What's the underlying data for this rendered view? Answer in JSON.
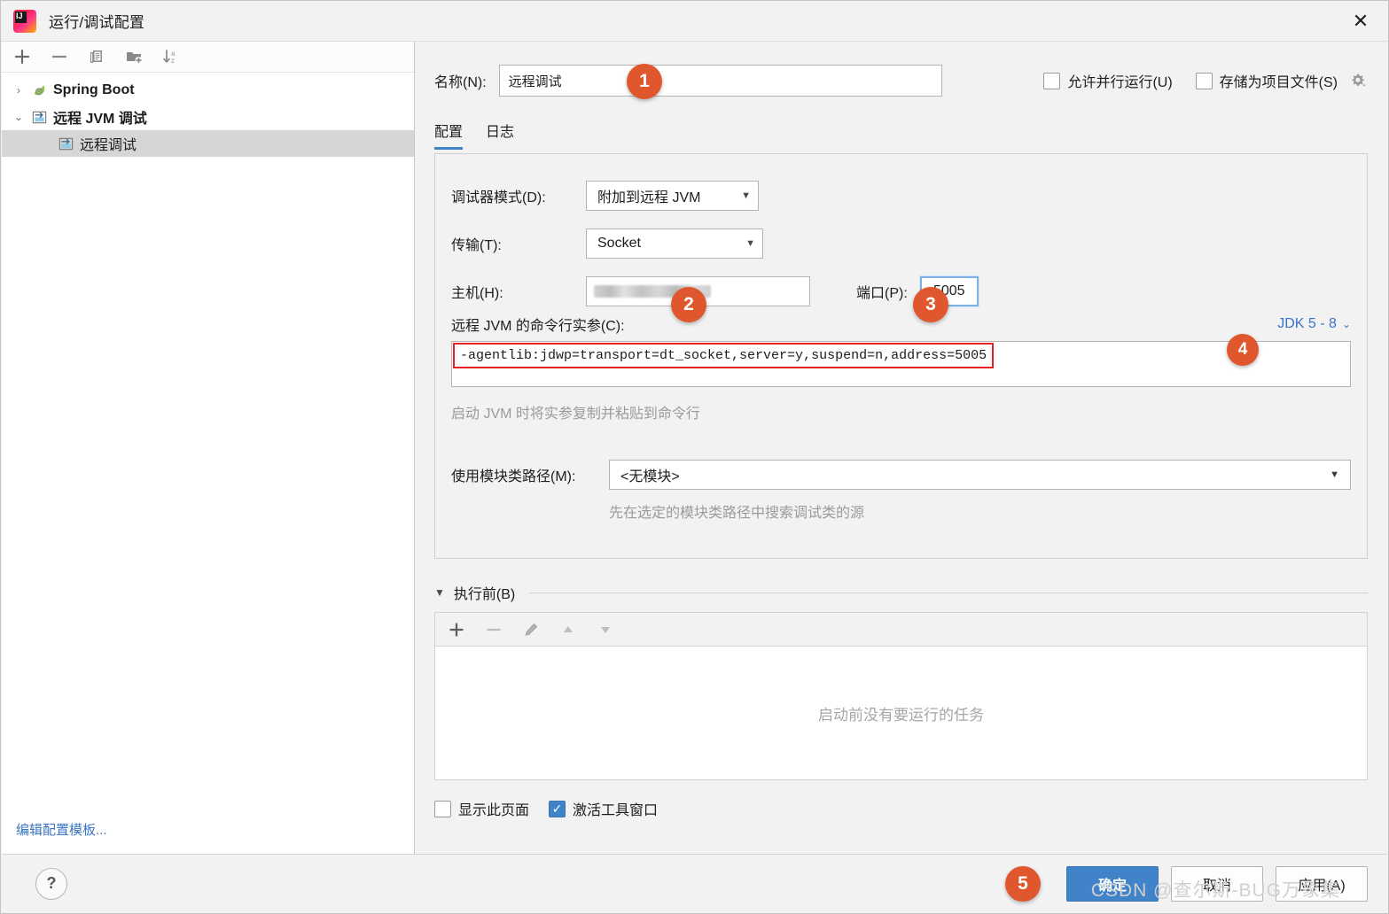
{
  "window": {
    "title": "运行/调试配置",
    "app_icon": "intellij-idea-icon",
    "close_label": "✕"
  },
  "left_panel": {
    "toolbar": [
      {
        "name": "add-configuration-button",
        "glyph": "+"
      },
      {
        "name": "remove-configuration-button",
        "glyph": "−"
      },
      {
        "name": "copy-configuration-button",
        "glyph": "copy-icon"
      },
      {
        "name": "new-folder-button",
        "glyph": "folder-add-icon"
      },
      {
        "name": "sort-configurations-button",
        "glyph": "sort-az-icon"
      }
    ],
    "tree": [
      {
        "label": "Spring Boot",
        "expanded": false,
        "twisty": "›",
        "icon": "spring-boot-icon",
        "level": 0,
        "selected": false
      },
      {
        "label": "远程 JVM 调试",
        "expanded": true,
        "twisty": "⌄",
        "icon": "remote-jvm-debug-icon",
        "level": 0,
        "selected": false
      },
      {
        "label": "远程调试",
        "expanded": null,
        "twisty": "",
        "icon": "remote-jvm-debug-icon",
        "level": 1,
        "selected": true
      }
    ],
    "edit_templates_link": "编辑配置模板..."
  },
  "main": {
    "name_label": "名称(N):",
    "name_value": "远程调试",
    "allow_parallel_run": {
      "label": "允许并行运行(U)",
      "checked": false
    },
    "store_as_project_file": {
      "label": "存储为项目文件(S)",
      "checked": false
    },
    "gear_icon": "gear-icon",
    "tabs": [
      {
        "label": "配置",
        "active": true
      },
      {
        "label": "日志",
        "active": false
      }
    ],
    "debugger_mode": {
      "label": "调试器模式(D):",
      "value": "附加到远程 JVM"
    },
    "transport": {
      "label": "传输(T):",
      "value": "Socket"
    },
    "host": {
      "label": "主机(H):",
      "value": "",
      "masked": true
    },
    "port": {
      "label": "端口(P):",
      "value": "5005"
    },
    "args": {
      "label": "远程 JVM 的命令行实参(C):",
      "value": "-agentlib:jdwp=transport=dt_socket,server=y,suspend=n,address=5005",
      "jdk_select": "JDK 5 - 8",
      "hint": "启动 JVM 时将实参复制并粘贴到命令行"
    },
    "module": {
      "label": "使用模块类路径(M):",
      "value": "<无模块>",
      "hint": "先在选定的模块类路径中搜索调试类的源"
    },
    "before_launch": {
      "title": "执行前(B)",
      "toolbar": [
        {
          "name": "add-task-button",
          "glyph": "+"
        },
        {
          "name": "remove-task-button",
          "glyph": "−"
        },
        {
          "name": "edit-task-button",
          "glyph": "pencil-icon"
        },
        {
          "name": "move-task-up-button",
          "glyph": "▲"
        },
        {
          "name": "move-task-down-button",
          "glyph": "▼"
        }
      ],
      "empty_text": "启动前没有要运行的任务"
    },
    "show_this_page": {
      "label": "显示此页面",
      "checked": false
    },
    "activate_tool_window": {
      "label": "激活工具窗口",
      "checked": true
    }
  },
  "footer": {
    "help_label": "?",
    "ok_label": "确定",
    "cancel_label": "取消",
    "apply_label": "应用(A)"
  },
  "badges": [
    {
      "number": "1"
    },
    {
      "number": "2"
    },
    {
      "number": "3"
    },
    {
      "number": "4"
    },
    {
      "number": "5"
    }
  ],
  "watermark": "CSDN @查尔斯-BUG万象集",
  "colors": {
    "accent_blue": "#4083c9",
    "badge_orange": "#e0562d",
    "link_blue": "#3a74c4",
    "highlight_red": "#e52222",
    "panel_bg": "#f2f2f2"
  }
}
